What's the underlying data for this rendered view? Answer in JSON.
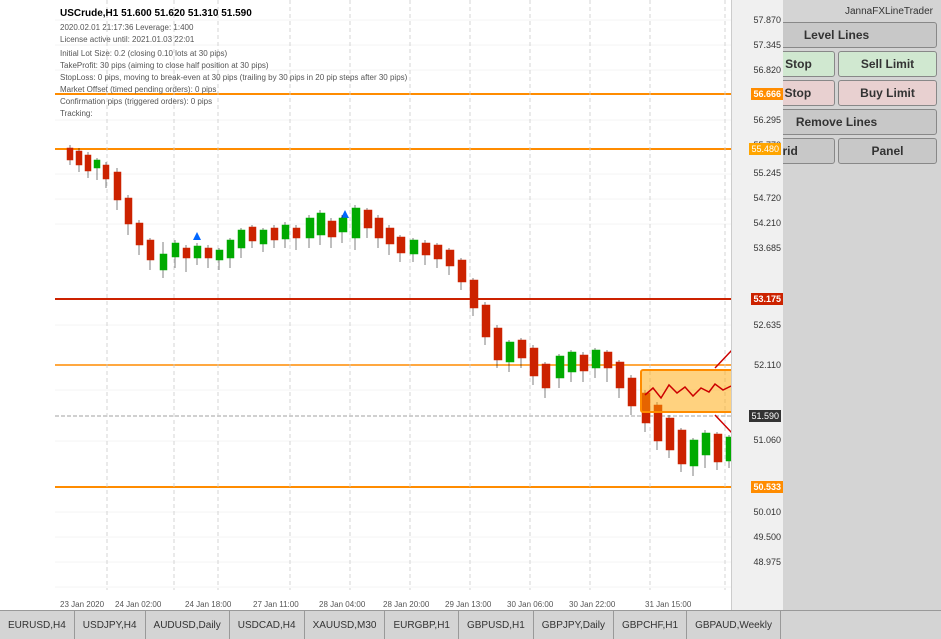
{
  "app_title": "JannaFXLineTrader",
  "chart": {
    "symbol": "USCrude,H1",
    "price_current": "51.600 51.620 51.310 51.590",
    "datetime": "2020.02.01 21:17:36",
    "leverage": "Leverage: 1:400",
    "license": "License active until: 2021.01.03 22:01",
    "lot_size": "Initial Lot Size: 0.2  (closing 0.10 lots at 30 pips)",
    "takeprofit": "TakeProfit: 30 pips  (aiming to close half position at 30 pips)",
    "stoploss": "StopLoss: 0 pips, moving to break-even at 30 pips  (trailing by 30 pips in 20 pip steps after 30 pips)",
    "market_offset": "Market Offset (timed pending orders): 0 pips",
    "confirmation_pips": "Confirmation pips (triggered orders): 0 pips",
    "tracking": "Tracking:"
  },
  "price_levels": {
    "top": "57.870",
    "l1": "57.345",
    "l2": "56.820",
    "l3_orange": "56.666",
    "l4": "56.295",
    "l5": "55.770",
    "l6_orange": "55.480",
    "l7": "55.245",
    "l8": "54.720",
    "l9": "54.210",
    "l10": "53.685",
    "l11_red": "53.175",
    "l12": "52.635",
    "l13": "52.110",
    "l14_current": "51.590",
    "l15": "51.060",
    "l16_orange": "50.533",
    "l17": "50.010",
    "l18": "49.500",
    "bottom": "48.975"
  },
  "panel": {
    "title": "JannaFXLineTrader",
    "level_lines_label": "Level Lines",
    "buy_stop_label": "Buy Stop",
    "sell_limit_label": "Sell Limit",
    "sell_stop_label": "Sell Stop",
    "buy_limit_label": "Buy Limit",
    "remove_lines_label": "Remove Lines",
    "grid_label": "Grid",
    "panel_label": "Panel"
  },
  "tabs": [
    {
      "label": "EURUSD,H4",
      "active": false
    },
    {
      "label": "USDJPY,H4",
      "active": false
    },
    {
      "label": "AUDUSD,Daily",
      "active": false
    },
    {
      "label": "USDCAD,H4",
      "active": false
    },
    {
      "label": "XAUUSD,M30",
      "active": false
    },
    {
      "label": "EURGBP,H1",
      "active": false
    },
    {
      "label": "GBPUSD,H1",
      "active": false
    },
    {
      "label": "GBPJPY,Daily",
      "active": false
    },
    {
      "label": "GBPCHF,H1",
      "active": false
    },
    {
      "label": "GBPAUD,Weekly",
      "active": false
    }
  ],
  "x_labels": [
    "23 Jan 2020",
    "24 Jan 02:00",
    "24 Jan 18:00",
    "27 Jan 11:00",
    "28 Jan 04:00",
    "28 Jan 20:00",
    "29 Jan 13:00",
    "30 Jan 06:00",
    "30 Jan 22:00",
    "31 Jan 15:00"
  ]
}
